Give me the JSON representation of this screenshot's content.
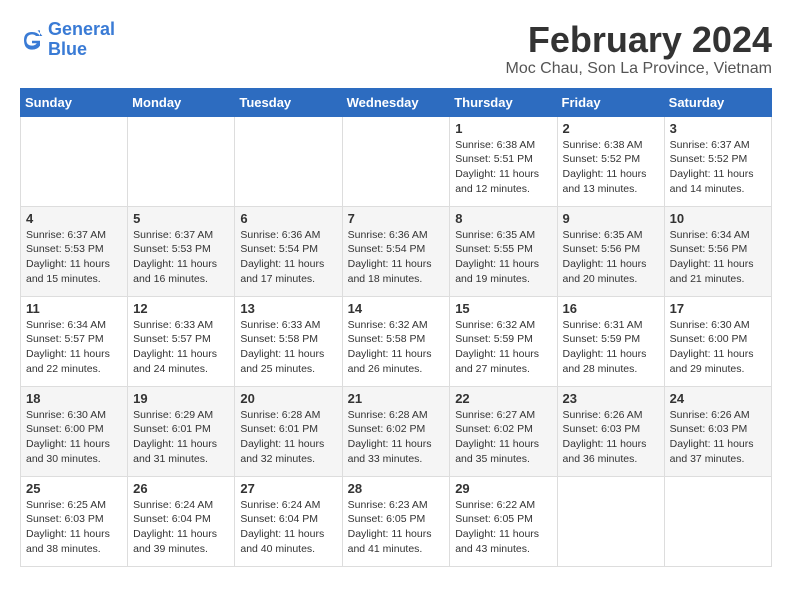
{
  "logo": {
    "line1": "General",
    "line2": "Blue"
  },
  "title": "February 2024",
  "location": "Moc Chau, Son La Province, Vietnam",
  "days_of_week": [
    "Sunday",
    "Monday",
    "Tuesday",
    "Wednesday",
    "Thursday",
    "Friday",
    "Saturday"
  ],
  "weeks": [
    [
      {
        "day": "",
        "info": ""
      },
      {
        "day": "",
        "info": ""
      },
      {
        "day": "",
        "info": ""
      },
      {
        "day": "",
        "info": ""
      },
      {
        "day": "1",
        "info": "Sunrise: 6:38 AM\nSunset: 5:51 PM\nDaylight: 11 hours and 12 minutes."
      },
      {
        "day": "2",
        "info": "Sunrise: 6:38 AM\nSunset: 5:52 PM\nDaylight: 11 hours and 13 minutes."
      },
      {
        "day": "3",
        "info": "Sunrise: 6:37 AM\nSunset: 5:52 PM\nDaylight: 11 hours and 14 minutes."
      }
    ],
    [
      {
        "day": "4",
        "info": "Sunrise: 6:37 AM\nSunset: 5:53 PM\nDaylight: 11 hours and 15 minutes."
      },
      {
        "day": "5",
        "info": "Sunrise: 6:37 AM\nSunset: 5:53 PM\nDaylight: 11 hours and 16 minutes."
      },
      {
        "day": "6",
        "info": "Sunrise: 6:36 AM\nSunset: 5:54 PM\nDaylight: 11 hours and 17 minutes."
      },
      {
        "day": "7",
        "info": "Sunrise: 6:36 AM\nSunset: 5:54 PM\nDaylight: 11 hours and 18 minutes."
      },
      {
        "day": "8",
        "info": "Sunrise: 6:35 AM\nSunset: 5:55 PM\nDaylight: 11 hours and 19 minutes."
      },
      {
        "day": "9",
        "info": "Sunrise: 6:35 AM\nSunset: 5:56 PM\nDaylight: 11 hours and 20 minutes."
      },
      {
        "day": "10",
        "info": "Sunrise: 6:34 AM\nSunset: 5:56 PM\nDaylight: 11 hours and 21 minutes."
      }
    ],
    [
      {
        "day": "11",
        "info": "Sunrise: 6:34 AM\nSunset: 5:57 PM\nDaylight: 11 hours and 22 minutes."
      },
      {
        "day": "12",
        "info": "Sunrise: 6:33 AM\nSunset: 5:57 PM\nDaylight: 11 hours and 24 minutes."
      },
      {
        "day": "13",
        "info": "Sunrise: 6:33 AM\nSunset: 5:58 PM\nDaylight: 11 hours and 25 minutes."
      },
      {
        "day": "14",
        "info": "Sunrise: 6:32 AM\nSunset: 5:58 PM\nDaylight: 11 hours and 26 minutes."
      },
      {
        "day": "15",
        "info": "Sunrise: 6:32 AM\nSunset: 5:59 PM\nDaylight: 11 hours and 27 minutes."
      },
      {
        "day": "16",
        "info": "Sunrise: 6:31 AM\nSunset: 5:59 PM\nDaylight: 11 hours and 28 minutes."
      },
      {
        "day": "17",
        "info": "Sunrise: 6:30 AM\nSunset: 6:00 PM\nDaylight: 11 hours and 29 minutes."
      }
    ],
    [
      {
        "day": "18",
        "info": "Sunrise: 6:30 AM\nSunset: 6:00 PM\nDaylight: 11 hours and 30 minutes."
      },
      {
        "day": "19",
        "info": "Sunrise: 6:29 AM\nSunset: 6:01 PM\nDaylight: 11 hours and 31 minutes."
      },
      {
        "day": "20",
        "info": "Sunrise: 6:28 AM\nSunset: 6:01 PM\nDaylight: 11 hours and 32 minutes."
      },
      {
        "day": "21",
        "info": "Sunrise: 6:28 AM\nSunset: 6:02 PM\nDaylight: 11 hours and 33 minutes."
      },
      {
        "day": "22",
        "info": "Sunrise: 6:27 AM\nSunset: 6:02 PM\nDaylight: 11 hours and 35 minutes."
      },
      {
        "day": "23",
        "info": "Sunrise: 6:26 AM\nSunset: 6:03 PM\nDaylight: 11 hours and 36 minutes."
      },
      {
        "day": "24",
        "info": "Sunrise: 6:26 AM\nSunset: 6:03 PM\nDaylight: 11 hours and 37 minutes."
      }
    ],
    [
      {
        "day": "25",
        "info": "Sunrise: 6:25 AM\nSunset: 6:03 PM\nDaylight: 11 hours and 38 minutes."
      },
      {
        "day": "26",
        "info": "Sunrise: 6:24 AM\nSunset: 6:04 PM\nDaylight: 11 hours and 39 minutes."
      },
      {
        "day": "27",
        "info": "Sunrise: 6:24 AM\nSunset: 6:04 PM\nDaylight: 11 hours and 40 minutes."
      },
      {
        "day": "28",
        "info": "Sunrise: 6:23 AM\nSunset: 6:05 PM\nDaylight: 11 hours and 41 minutes."
      },
      {
        "day": "29",
        "info": "Sunrise: 6:22 AM\nSunset: 6:05 PM\nDaylight: 11 hours and 43 minutes."
      },
      {
        "day": "",
        "info": ""
      },
      {
        "day": "",
        "info": ""
      }
    ]
  ]
}
